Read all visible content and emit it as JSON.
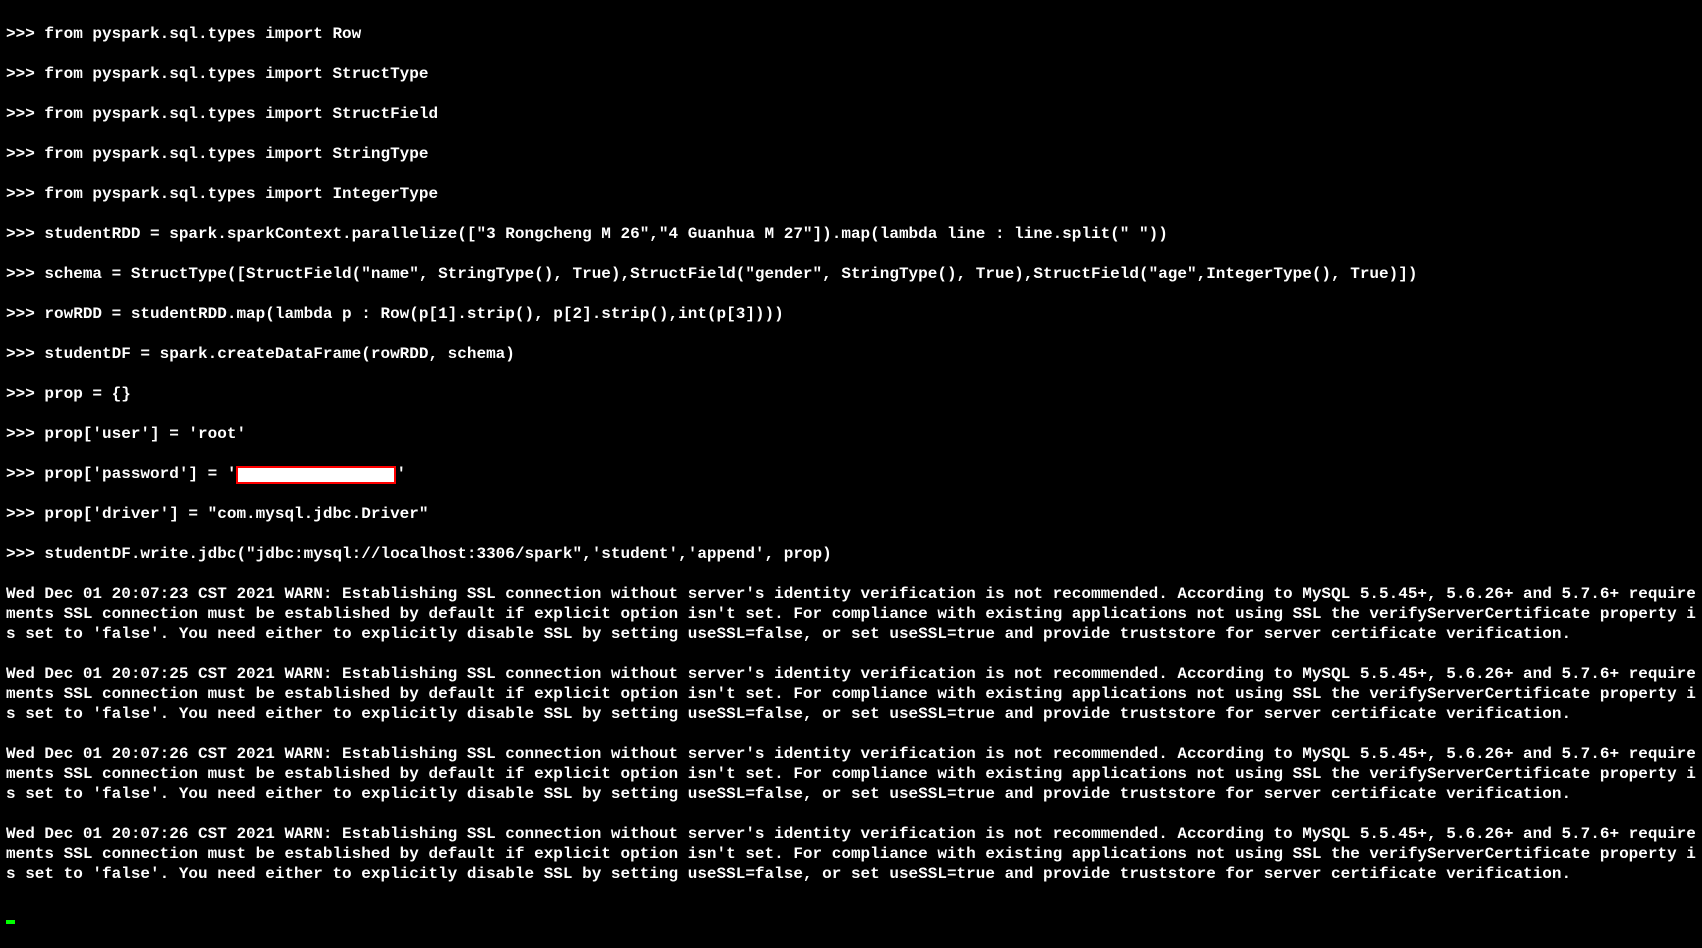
{
  "terminal": {
    "prompt": ">>> ",
    "lines": {
      "l01": "from pyspark.sql.types import Row",
      "l02": "from pyspark.sql.types import StructType",
      "l03": "from pyspark.sql.types import StructField",
      "l04": "from pyspark.sql.types import StringType",
      "l05": "from pyspark.sql.types import IntegerType",
      "l06": "studentRDD = spark.sparkContext.parallelize([\"3 Rongcheng M 26\",\"4 Guanhua M 27\"]).map(lambda line : line.split(\" \"))",
      "l07": "schema = StructType([StructField(\"name\", StringType(), True),StructField(\"gender\", StringType(), True),StructField(\"age\",IntegerType(), True)])",
      "l08": "rowRDD = studentRDD.map(lambda p : Row(p[1].strip(), p[2].strip(),int(p[3])))",
      "l09": "studentDF = spark.createDataFrame(rowRDD, schema)",
      "l10": "prop = {}",
      "l11": "prop['user'] = 'root'",
      "l12a": "prop['password'] = '",
      "l12b": "'",
      "l13": "prop['driver'] = \"com.mysql.jdbc.Driver\"",
      "l14": "studentDF.write.jdbc(\"jdbc:mysql://localhost:3306/spark\",'student','append', prop)"
    },
    "warnings": {
      "w1": "Wed Dec 01 20:07:23 CST 2021 WARN: Establishing SSL connection without server's identity verification is not recommended. According to MySQL 5.5.45+, 5.6.26+ and 5.7.6+ requirements SSL connection must be established by default if explicit option isn't set. For compliance with existing applications not using SSL the verifyServerCertificate property is set to 'false'. You need either to explicitly disable SSL by setting useSSL=false, or set useSSL=true and provide truststore for server certificate verification.",
      "w2": "Wed Dec 01 20:07:25 CST 2021 WARN: Establishing SSL connection without server's identity verification is not recommended. According to MySQL 5.5.45+, 5.6.26+ and 5.7.6+ requirements SSL connection must be established by default if explicit option isn't set. For compliance with existing applications not using SSL the verifyServerCertificate property is set to 'false'. You need either to explicitly disable SSL by setting useSSL=false, or set useSSL=true and provide truststore for server certificate verification.",
      "w3": "Wed Dec 01 20:07:26 CST 2021 WARN: Establishing SSL connection without server's identity verification is not recommended. According to MySQL 5.5.45+, 5.6.26+ and 5.7.6+ requirements SSL connection must be established by default if explicit option isn't set. For compliance with existing applications not using SSL the verifyServerCertificate property is set to 'false'. You need either to explicitly disable SSL by setting useSSL=false, or set useSSL=true and provide truststore for server certificate verification.",
      "w4": "Wed Dec 01 20:07:26 CST 2021 WARN: Establishing SSL connection without server's identity verification is not recommended. According to MySQL 5.5.45+, 5.6.26+ and 5.7.6+ requirements SSL connection must be established by default if explicit option isn't set. For compliance with existing applications not using SSL the verifyServerCertificate property is set to 'false'. You need either to explicitly disable SSL by setting useSSL=false, or set useSSL=true and provide truststore for server certificate verification."
    }
  }
}
